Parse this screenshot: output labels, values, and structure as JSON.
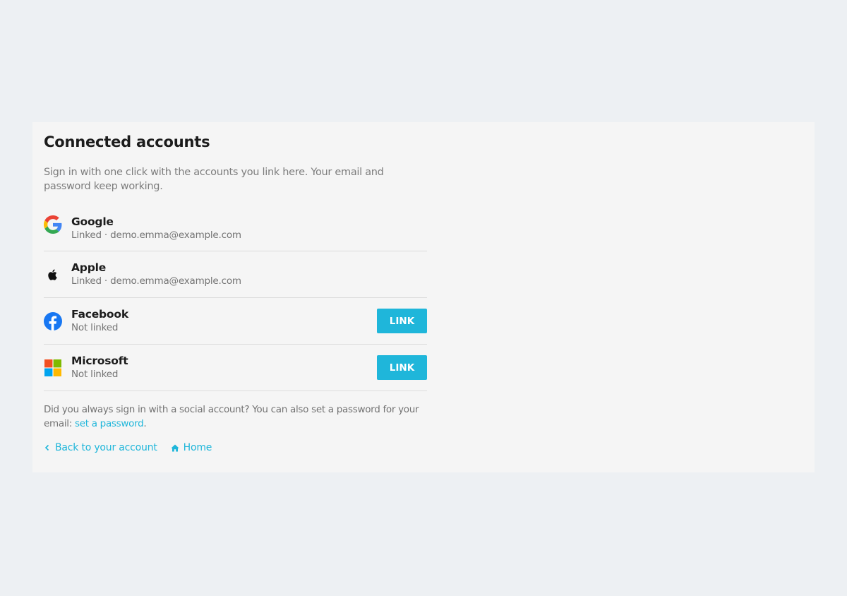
{
  "page": {
    "title": "Connected accounts",
    "intro": "Sign in with one click with the accounts you link here. Your email and password keep working."
  },
  "accounts": [
    {
      "provider": "Google",
      "status": "Linked · demo.emma@example.com",
      "icon": "google-icon",
      "button": ""
    },
    {
      "provider": "Apple",
      "status": "Linked · demo.emma@example.com",
      "icon": "apple-icon",
      "button": ""
    },
    {
      "provider": "Facebook",
      "status": "Not linked",
      "icon": "facebook-icon",
      "button": "LINK"
    },
    {
      "provider": "Microsoft",
      "status": "Not linked",
      "icon": "microsoft-icon",
      "button": "LINK"
    }
  ],
  "note": {
    "text": "Did you always sign in with a social account? You can also set a password for your email: ",
    "link_text": "set a password",
    "suffix": "."
  },
  "footer": {
    "back_label": "Back to your account",
    "home_label": "Home"
  },
  "colors": {
    "accent": "#1fb6da",
    "page_background": "#edf0f3",
    "card_background": "#f5f5f5",
    "facebook": "#1877f2"
  }
}
